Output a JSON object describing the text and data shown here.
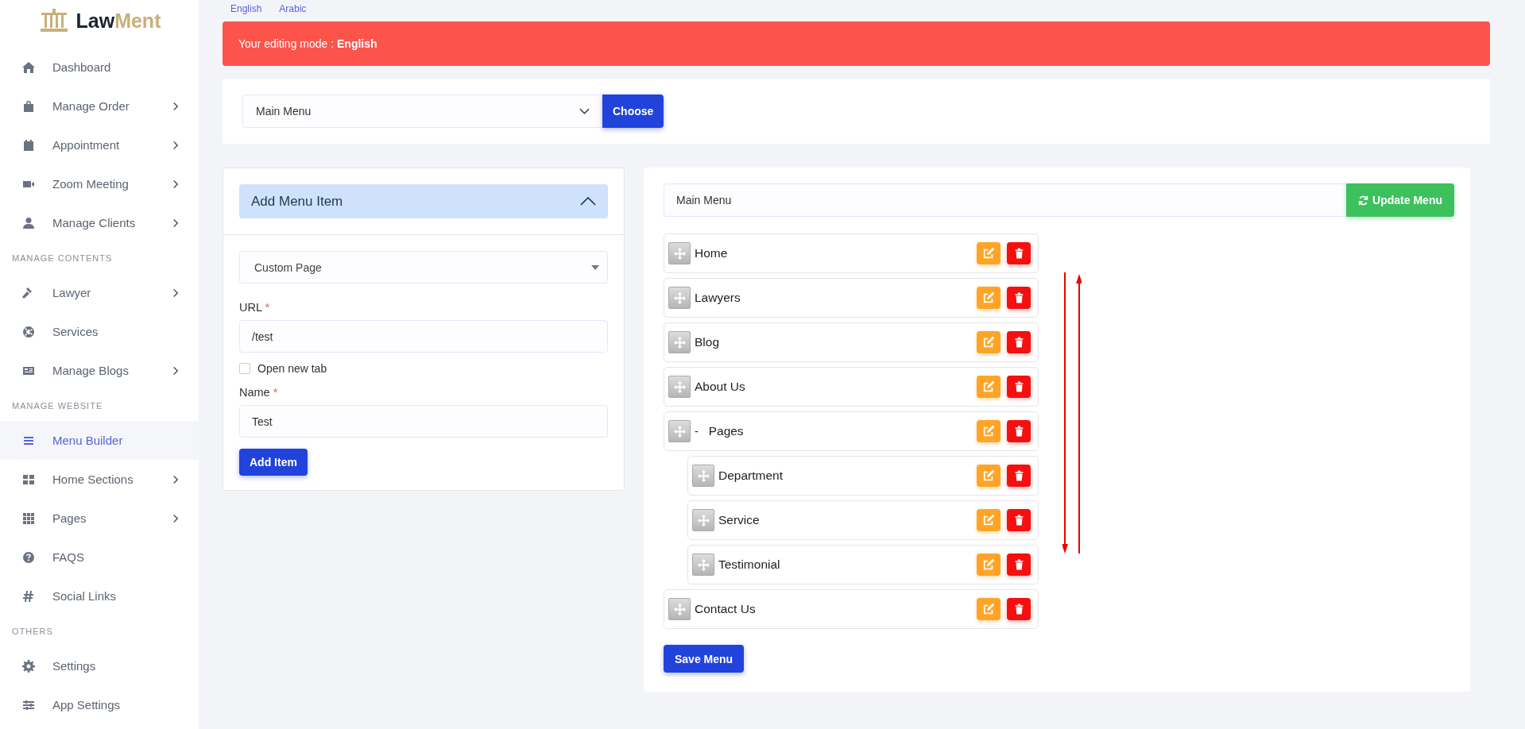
{
  "sidebar": {
    "logo": {
      "text_dark": "Law",
      "text_gold": "Ment"
    },
    "items": [
      {
        "kind": "link",
        "label": "Dashboard",
        "has_submenu": false,
        "selected": false
      },
      {
        "kind": "link",
        "label": "Manage Order",
        "has_submenu": true,
        "selected": false
      },
      {
        "kind": "link",
        "label": "Appointment",
        "has_submenu": true,
        "selected": false
      },
      {
        "kind": "link",
        "label": "Zoom Meeting",
        "has_submenu": true,
        "selected": false
      },
      {
        "kind": "link",
        "label": "Manage Clients",
        "has_submenu": true,
        "selected": false
      },
      {
        "kind": "section",
        "label": "MANAGE CONTENTS"
      },
      {
        "kind": "link",
        "label": "Lawyer",
        "has_submenu": true,
        "selected": false
      },
      {
        "kind": "link",
        "label": "Services",
        "has_submenu": false,
        "selected": false
      },
      {
        "kind": "link",
        "label": "Manage Blogs",
        "has_submenu": true,
        "selected": false
      },
      {
        "kind": "section",
        "label": "MANAGE WEBSITE"
      },
      {
        "kind": "link",
        "label": "Menu Builder",
        "has_submenu": false,
        "selected": true
      },
      {
        "kind": "link",
        "label": "Home Sections",
        "has_submenu": true,
        "selected": false
      },
      {
        "kind": "link",
        "label": "Pages",
        "has_submenu": true,
        "selected": false
      },
      {
        "kind": "link",
        "label": "FAQS",
        "has_submenu": false,
        "selected": false
      },
      {
        "kind": "link",
        "label": "Social Links",
        "has_submenu": false,
        "selected": false
      },
      {
        "kind": "section",
        "label": "OTHERS"
      },
      {
        "kind": "link",
        "label": "Settings",
        "has_submenu": false,
        "selected": false
      },
      {
        "kind": "link",
        "label": "App Settings",
        "has_submenu": false,
        "selected": false
      }
    ]
  },
  "languages": [
    {
      "label": "English"
    },
    {
      "label": "Arabic"
    }
  ],
  "alert": {
    "text": "Your editing mode : **English**"
  },
  "menu_picker": {
    "value": "Main Menu",
    "button": "Choose"
  },
  "add_item": {
    "title": "Add Menu Item",
    "expanded": true,
    "type_value": "Custom Page",
    "url": {
      "label": "URL",
      "required_mark": "*",
      "value": "/test"
    },
    "open_new_tab": {
      "label": "Open new tab",
      "checked": false
    },
    "name": {
      "label": "Name",
      "required_mark": "*",
      "value": "Test"
    },
    "button": "Add Item"
  },
  "menu_editor": {
    "menu_name": "Main Menu",
    "update_button": "Update Menu",
    "items": [
      {
        "label": "Home"
      },
      {
        "label": "Lawyers"
      },
      {
        "label": "Blog"
      },
      {
        "label": "About Us"
      },
      {
        "label": "Pages",
        "toggle": "-",
        "children": [
          {
            "label": "Department"
          },
          {
            "label": "Service"
          },
          {
            "label": "Testimonial"
          }
        ]
      },
      {
        "label": "Contact Us"
      }
    ],
    "save_button": "Save Menu"
  }
}
